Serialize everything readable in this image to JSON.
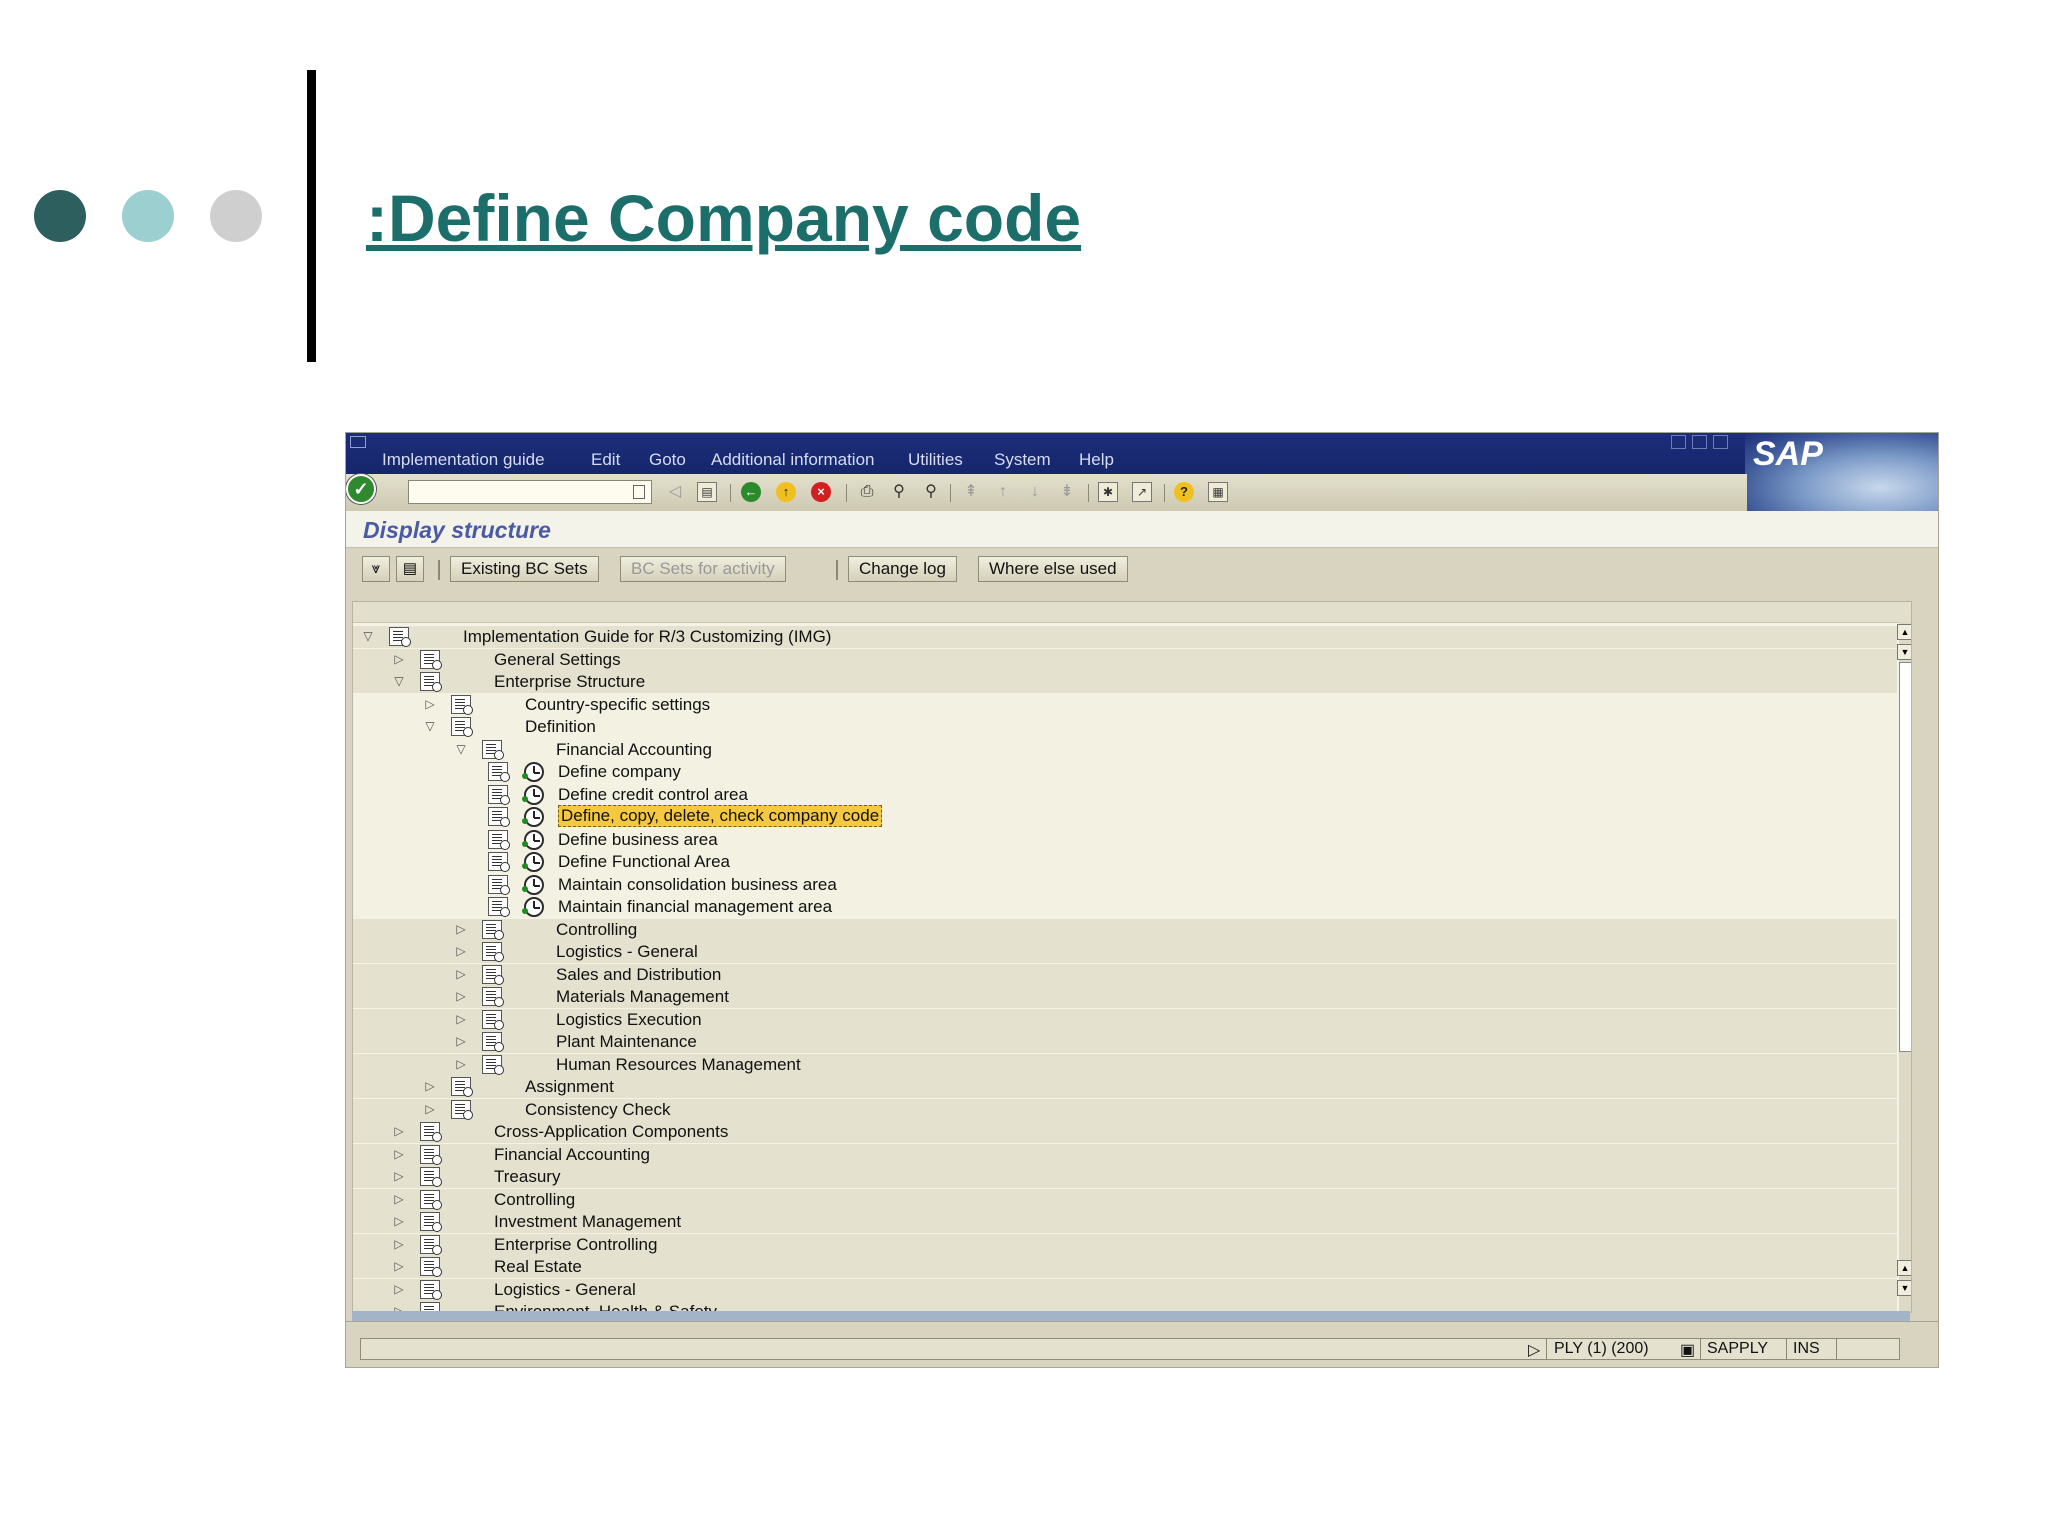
{
  "slide": {
    "title": ":Define Company code"
  },
  "sap": {
    "logo": "SAP",
    "menu": [
      "Implementation guide",
      "Edit",
      "Goto",
      "Additional information",
      "Utilities",
      "System",
      "Help"
    ],
    "screen_title": "Display structure",
    "toolbar2": {
      "existing_bc_sets": "Existing BC Sets",
      "bc_sets_for_activity": "BC Sets for activity",
      "change_log": "Change log",
      "where_else_used": "Where else used"
    },
    "tree": [
      {
        "level": 0,
        "expander": "open",
        "icon": "doc",
        "label": "Implementation Guide for R/3 Customizing (IMG)"
      },
      {
        "level": 1,
        "expander": "closed",
        "icon": "doc",
        "label": "General Settings"
      },
      {
        "level": 1,
        "expander": "open",
        "icon": "doc",
        "label": "Enterprise Structure"
      },
      {
        "level": 2,
        "expander": "closed",
        "icon": "doc",
        "label": "Country-specific settings"
      },
      {
        "level": 2,
        "expander": "open",
        "icon": "doc",
        "label": "Definition"
      },
      {
        "level": 3,
        "expander": "open",
        "icon": "doc",
        "label": "Financial Accounting"
      },
      {
        "level": 4,
        "expander": "none",
        "icon": "activity",
        "label": "Define company"
      },
      {
        "level": 4,
        "expander": "none",
        "icon": "activity",
        "label": "Define credit control area"
      },
      {
        "level": 4,
        "expander": "none",
        "icon": "activity",
        "label": "Define, copy, delete, check company code",
        "selected": true
      },
      {
        "level": 4,
        "expander": "none",
        "icon": "activity",
        "label": "Define business area"
      },
      {
        "level": 4,
        "expander": "none",
        "icon": "activity",
        "label": "Define Functional Area"
      },
      {
        "level": 4,
        "expander": "none",
        "icon": "activity",
        "label": "Maintain consolidation business area"
      },
      {
        "level": 4,
        "expander": "none",
        "icon": "activity",
        "label": "Maintain financial management area"
      },
      {
        "level": 3,
        "expander": "closed",
        "icon": "doc",
        "label": "Controlling"
      },
      {
        "level": 3,
        "expander": "closed",
        "icon": "doc",
        "label": "Logistics - General"
      },
      {
        "level": 3,
        "expander": "closed",
        "icon": "doc",
        "label": "Sales and Distribution"
      },
      {
        "level": 3,
        "expander": "closed",
        "icon": "doc",
        "label": "Materials Management"
      },
      {
        "level": 3,
        "expander": "closed",
        "icon": "doc",
        "label": "Logistics Execution"
      },
      {
        "level": 3,
        "expander": "closed",
        "icon": "doc",
        "label": "Plant Maintenance"
      },
      {
        "level": 3,
        "expander": "closed",
        "icon": "doc",
        "label": "Human Resources Management"
      },
      {
        "level": 2,
        "expander": "closed",
        "icon": "doc",
        "label": "Assignment"
      },
      {
        "level": 2,
        "expander": "closed",
        "icon": "doc",
        "label": "Consistency Check"
      },
      {
        "level": 1,
        "expander": "closed",
        "icon": "doc",
        "label": "Cross-Application Components"
      },
      {
        "level": 1,
        "expander": "closed",
        "icon": "doc",
        "label": "Financial Accounting"
      },
      {
        "level": 1,
        "expander": "closed",
        "icon": "doc",
        "label": "Treasury"
      },
      {
        "level": 1,
        "expander": "closed",
        "icon": "doc",
        "label": "Controlling"
      },
      {
        "level": 1,
        "expander": "closed",
        "icon": "doc",
        "label": "Investment Management"
      },
      {
        "level": 1,
        "expander": "closed",
        "icon": "doc",
        "label": "Enterprise Controlling"
      },
      {
        "level": 1,
        "expander": "closed",
        "icon": "doc",
        "label": "Real Estate"
      },
      {
        "level": 1,
        "expander": "closed",
        "icon": "doc",
        "label": "Logistics - General"
      },
      {
        "level": 1,
        "expander": "closed",
        "icon": "doc",
        "label": "Environment, Health & Safety"
      }
    ],
    "status": {
      "system": "PLY (1) (200)",
      "server": "SAPPLY",
      "mode": "INS"
    }
  }
}
